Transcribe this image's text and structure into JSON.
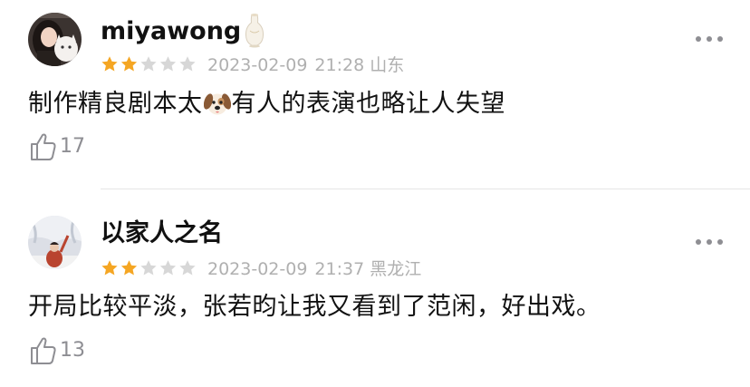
{
  "colors": {
    "star_filled": "#f5a623",
    "star_empty": "#d7d7d7",
    "meta_text": "#b0b0b0",
    "like_text": "#8e8e93",
    "divider": "#e6e6e6"
  },
  "comments": [
    {
      "username": "miyawong",
      "badge_icon": "vase-badge-icon",
      "rating": {
        "filled": 2,
        "total": 5
      },
      "date": "2023-02-09",
      "time": "21:28",
      "location": "山东",
      "text_before_emoji": "制作精良剧本太",
      "emoji": "dog-face-emoji",
      "text_after_emoji": "有人的表演也略让人失望",
      "likes": "17"
    },
    {
      "username": "以家人之名",
      "rating": {
        "filled": 2,
        "total": 5
      },
      "date": "2023-02-09",
      "time": "21:37",
      "location": "黑龙江",
      "text": "开局比较平淡，张若昀让我又看到了范闲，好出戏。",
      "likes": "13"
    }
  ]
}
